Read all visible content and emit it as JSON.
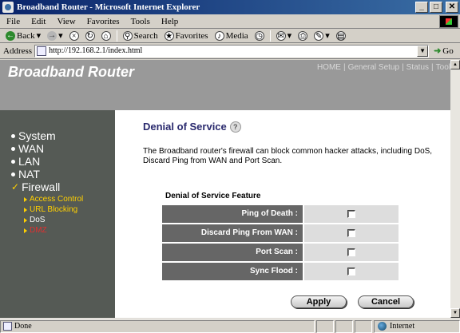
{
  "window": {
    "title": "Broadband Router - Microsoft Internet Explorer"
  },
  "menu": [
    "File",
    "Edit",
    "View",
    "Favorites",
    "Tools",
    "Help"
  ],
  "toolbar": {
    "back": "Back",
    "search": "Search",
    "favorites": "Favorites",
    "media": "Media"
  },
  "address": {
    "label": "Address",
    "url": "http://192.168.2.1/index.html",
    "go": "Go"
  },
  "header": {
    "brand": "Broadband Router",
    "nav": [
      "HOME",
      "General Setup",
      "Status",
      "Tool"
    ]
  },
  "sidebar": {
    "items": [
      "System",
      "WAN",
      "LAN",
      "NAT",
      "Firewall"
    ],
    "sub_items": [
      "Access Control",
      "URL Blocking",
      "DoS",
      "DMZ"
    ],
    "colors": {
      "active": "#ffd000",
      "selected": "#ffffff",
      "dmz": "#e03030"
    }
  },
  "main": {
    "title": "Denial of Service",
    "description": "The Broadband router's firewall can block common hacker attacks, including DoS, Discard Ping from WAN and Port Scan.",
    "feature_heading": "Denial of Service Feature",
    "features": [
      {
        "label": "Ping of Death :",
        "checked": false
      },
      {
        "label": "Discard Ping From WAN :",
        "checked": false
      },
      {
        "label": "Port Scan :",
        "checked": false
      },
      {
        "label": "Sync Flood :",
        "checked": false
      }
    ],
    "apply": "Apply",
    "cancel": "Cancel"
  },
  "status": {
    "text": "Done",
    "zone": "Internet"
  }
}
